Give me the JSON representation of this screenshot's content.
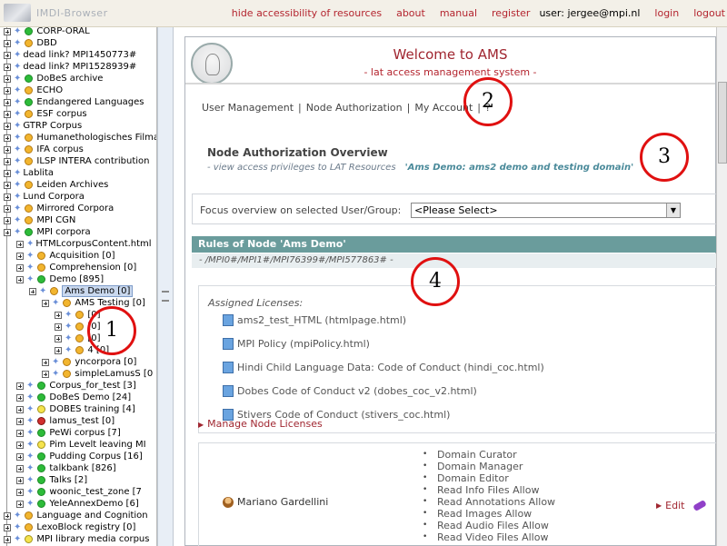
{
  "app": {
    "brand": "IMDI-Browser",
    "nav": [
      {
        "label": "hide accessibility of resources"
      },
      {
        "label": "about"
      },
      {
        "label": "manual"
      },
      {
        "label": "register"
      }
    ],
    "user_text": "user: jergee@mpi.nl",
    "login": "login",
    "logout": "logout"
  },
  "tree": {
    "items": [
      {
        "label": "CORP-ORAL",
        "dot": "green",
        "indent": 0
      },
      {
        "label": "DBD",
        "dot": "orange",
        "indent": 0
      },
      {
        "label": "dead link? MPI1450773#",
        "dot": "",
        "indent": 0
      },
      {
        "label": "dead link? MPI1528939#",
        "dot": "",
        "indent": 0
      },
      {
        "label": "DoBeS archive",
        "dot": "green",
        "indent": 0
      },
      {
        "label": "ECHO",
        "dot": "orange",
        "indent": 0
      },
      {
        "label": "Endangered Languages",
        "dot": "green",
        "indent": 0
      },
      {
        "label": "ESF corpus",
        "dot": "orange",
        "indent": 0
      },
      {
        "label": "GTRP Corpus",
        "dot": "",
        "indent": 0
      },
      {
        "label": "Humanethologisches Filma",
        "dot": "orange",
        "indent": 0
      },
      {
        "label": "IFA corpus",
        "dot": "orange",
        "indent": 0
      },
      {
        "label": "ILSP INTERA contribution",
        "dot": "orange",
        "indent": 0
      },
      {
        "label": "Lablita",
        "dot": "",
        "indent": 0
      },
      {
        "label": "Leiden Archives",
        "dot": "orange",
        "indent": 0
      },
      {
        "label": "Lund Corpora",
        "dot": "",
        "indent": 0
      },
      {
        "label": "Mirrored Corpora",
        "dot": "orange",
        "indent": 0
      },
      {
        "label": "MPI CGN",
        "dot": "orange",
        "indent": 0
      },
      {
        "label": "MPI corpora",
        "dot": "green",
        "indent": 0
      },
      {
        "label": "HTMLcorpusContent.html",
        "dot": "",
        "indent": 1
      },
      {
        "label": "Acquisition [0]",
        "dot": "orange",
        "indent": 1
      },
      {
        "label": "Comprehension [0]",
        "dot": "orange",
        "indent": 1
      },
      {
        "label": "Demo [895]",
        "dot": "green",
        "indent": 1
      },
      {
        "label": "Ams Demo [0]",
        "dot": "orange",
        "indent": 2,
        "selected": true
      },
      {
        "label": "AMS Testing [0]",
        "dot": "orange",
        "indent": 3
      },
      {
        "label": "[0]",
        "dot": "orange",
        "indent": 4
      },
      {
        "label": "[0]",
        "dot": "orange",
        "indent": 4
      },
      {
        "label": "[0]",
        "dot": "orange",
        "indent": 4
      },
      {
        "label": "4 [0]",
        "dot": "orange",
        "indent": 4
      },
      {
        "label": "yncorpora [0]",
        "dot": "orange",
        "indent": 3
      },
      {
        "label": "simpleLamusS [0",
        "dot": "orange",
        "indent": 3
      },
      {
        "label": "Corpus_for_test [3]",
        "dot": "green",
        "indent": 1
      },
      {
        "label": "DoBeS Demo [24]",
        "dot": "green",
        "indent": 1
      },
      {
        "label": "DOBES training [4]",
        "dot": "yellow",
        "indent": 1
      },
      {
        "label": "lamus_test [0]",
        "dot": "red",
        "indent": 1
      },
      {
        "label": "PeWi corpus [7]",
        "dot": "green",
        "indent": 1
      },
      {
        "label": "Pim Levelt leaving MI",
        "dot": "yellow",
        "indent": 1
      },
      {
        "label": "Pudding Corpus [16]",
        "dot": "green",
        "indent": 1
      },
      {
        "label": "talkbank [826]",
        "dot": "green",
        "indent": 1
      },
      {
        "label": "Talks [2]",
        "dot": "green",
        "indent": 1
      },
      {
        "label": "woonic_test_zone [7",
        "dot": "green",
        "indent": 1
      },
      {
        "label": "YeleAnnexDemo [6]",
        "dot": "green",
        "indent": 1
      },
      {
        "label": "Language and Cognition",
        "dot": "orange",
        "indent": 0
      },
      {
        "label": "LexoBlock registry [0]",
        "dot": "orange",
        "indent": 0
      },
      {
        "label": "MPI library media corpus",
        "dot": "yellow",
        "indent": 0
      }
    ]
  },
  "main": {
    "welcome": "Welcome to AMS",
    "subtitle": "- lat access management system -",
    "menu": [
      "User Management",
      "Node Authorization",
      "My Account",
      "?"
    ],
    "overview_title": "Node Authorization Overview",
    "overview_sub": "- view access privileges to LAT Resources",
    "overview_domain": "'Ams Demo: ams2 demo and testing domain'",
    "focus_label": "Focus overview on selected User/Group:",
    "focus_select": "<Please Select>",
    "rules_title": "Rules of Node 'Ams Demo'",
    "node_path": "- /MPI0#/MPI1#/MPI76399#/MPI577863# -",
    "licenses_title": "Assigned Licenses:",
    "licenses": [
      "ams2_test_HTML (htmlpage.html)",
      "MPI Policy (mpiPolicy.html)",
      "Hindi Child Language Data: Code of Conduct (hindi_coc.html)",
      "Dobes Code of Conduct v2 (dobes_coc_v2.html)",
      "Stivers Code of Conduct (stivers_coc.html)"
    ],
    "manage_licenses": "Manage Node Licenses",
    "user_name": "Mariano Gardellini",
    "privileges": [
      "Domain Curator",
      "Domain Manager",
      "Domain Editor",
      "Read Info Files Allow",
      "Read Annotations Allow",
      "Read Images Allow",
      "Read Audio Files Allow",
      "Read Video Files Allow"
    ],
    "edit": "Edit"
  },
  "markers": [
    "1",
    "2",
    "3",
    "4"
  ]
}
